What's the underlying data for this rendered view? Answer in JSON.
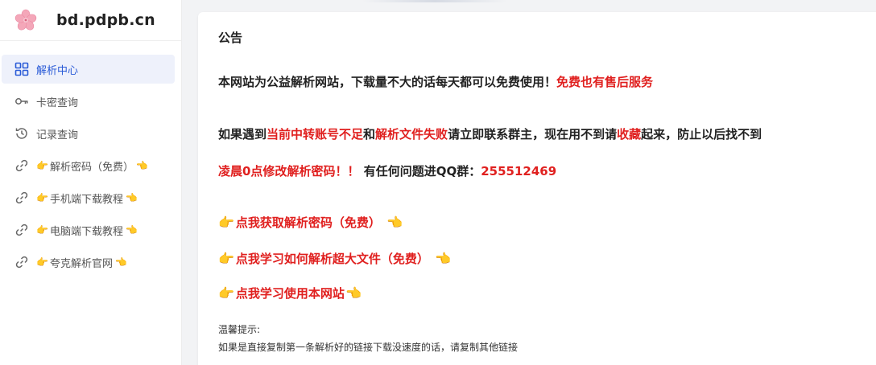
{
  "brand": {
    "title": "bd.pdpb.cn",
    "logo_icon": "sakura-flower-icon",
    "logo_color": "#f4a7b9"
  },
  "sidebar": {
    "items": [
      {
        "label": "解析中心",
        "icon": "grid-icon",
        "active": true
      },
      {
        "label": "卡密查询",
        "icon": "key-icon",
        "active": false
      },
      {
        "label": "记录查询",
        "icon": "history-icon",
        "active": false
      },
      {
        "label": "解析密码（免费）",
        "icon": "link-icon",
        "active": false,
        "hands": true
      },
      {
        "label": "手机端下载教程",
        "icon": "link-icon",
        "active": false,
        "hands": true
      },
      {
        "label": "电脑端下载教程",
        "icon": "link-icon",
        "active": false,
        "hands": true
      },
      {
        "label": "夸克解析官网",
        "icon": "link-icon",
        "active": false,
        "hands": true
      }
    ]
  },
  "notice": {
    "title": "公告",
    "line1_a": "本网站为公益解析网站，下载量不大的话每天都可以免费使用！",
    "line1_b": "免费也有售后服务",
    "line2_a": "如果遇到",
    "line2_b": "当前中转账号不足",
    "line2_c": "和",
    "line2_d": "解析文件失败",
    "line2_e": "请立即联系群主，现在用不到请",
    "line2_f": "收藏",
    "line2_g": "起来，防止以后找不到",
    "line3_a": "凌晨0点修改解析密码！！",
    "line3_b": "有任何问题进QQ群：",
    "line3_c": "255512469",
    "links": [
      {
        "label": "点我获取解析密码（免费）"
      },
      {
        "label": "点我学习如何解析超大文件（免费）"
      },
      {
        "label": "点我学习使用本网站"
      }
    ],
    "tips_title": "温馨提示:",
    "tips_text": "如果是直接复制第一条解析好的链接下载没速度的话，请复制其他链接"
  },
  "colors": {
    "accent": "#2a5bd7",
    "active_bg": "#eef1fb",
    "highlight_red": "#e0201f"
  }
}
